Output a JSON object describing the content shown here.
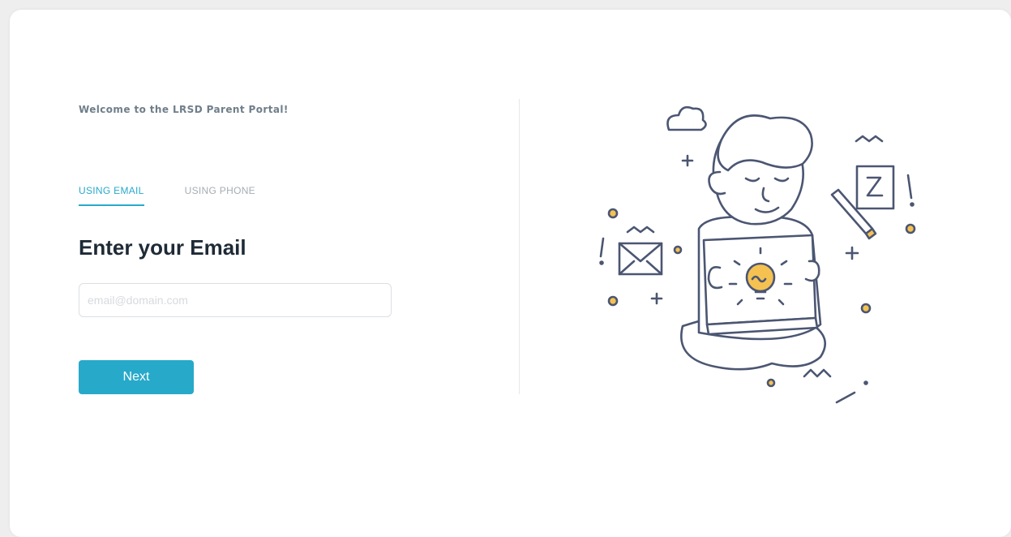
{
  "login": {
    "welcome_text": "Welcome to the LRSD Parent Portal!",
    "tabs": [
      {
        "label": "USING EMAIL",
        "active": true
      },
      {
        "label": "USING PHONE",
        "active": false
      }
    ],
    "heading": "Enter your Email",
    "email_input": {
      "value": "",
      "placeholder": "email@domain.com"
    },
    "next_label": "Next"
  },
  "colors": {
    "accent": "#27a9ca",
    "tab_inactive": "#a6adb3",
    "heading": "#1e2a36",
    "welcome": "#6f7e8a",
    "illustration_stroke": "#4b5672",
    "illustration_accent": "#f5c252"
  },
  "illustration": {
    "icon": "person-with-laptop-lightbulb-illustration"
  }
}
